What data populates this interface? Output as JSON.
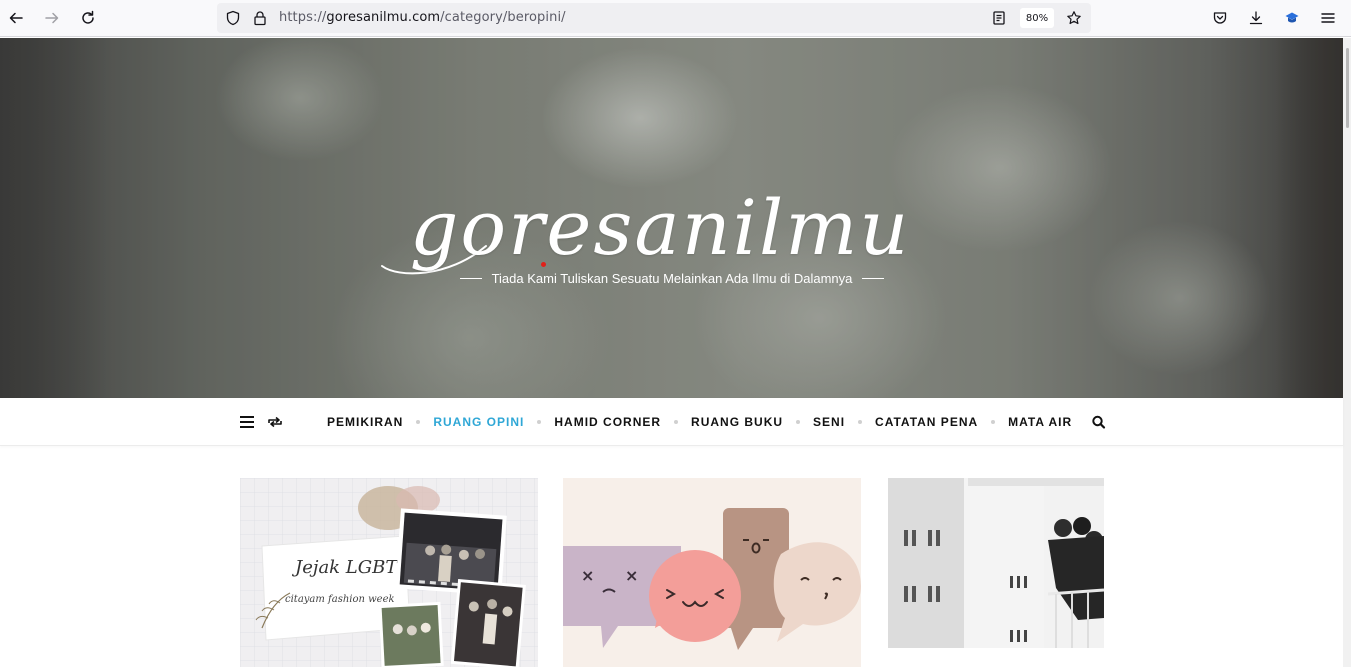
{
  "browser": {
    "url_prefix": "https://",
    "url_host": "goresanilmu.com",
    "url_path": "/category/beropini/",
    "zoom": "80%"
  },
  "site": {
    "title": "goresanilmu",
    "tagline": "Tiada Kami Tuliskan Sesuatu Melainkan Ada Ilmu di Dalamnya"
  },
  "nav": {
    "items": [
      {
        "label": "PEMIKIRAN",
        "active": false
      },
      {
        "label": "RUANG OPINI",
        "active": true
      },
      {
        "label": "HAMID CORNER",
        "active": false
      },
      {
        "label": "RUANG BUKU",
        "active": false
      },
      {
        "label": "SENI",
        "active": false
      },
      {
        "label": "CATATAN PENA",
        "active": false
      },
      {
        "label": "MATA AIR",
        "active": false
      }
    ],
    "accent_color": "#2fa7d6"
  },
  "cards": [
    {
      "image_text_1": "Jejak LGBT",
      "image_text_2": "citayam fashion week"
    },
    {},
    {}
  ]
}
